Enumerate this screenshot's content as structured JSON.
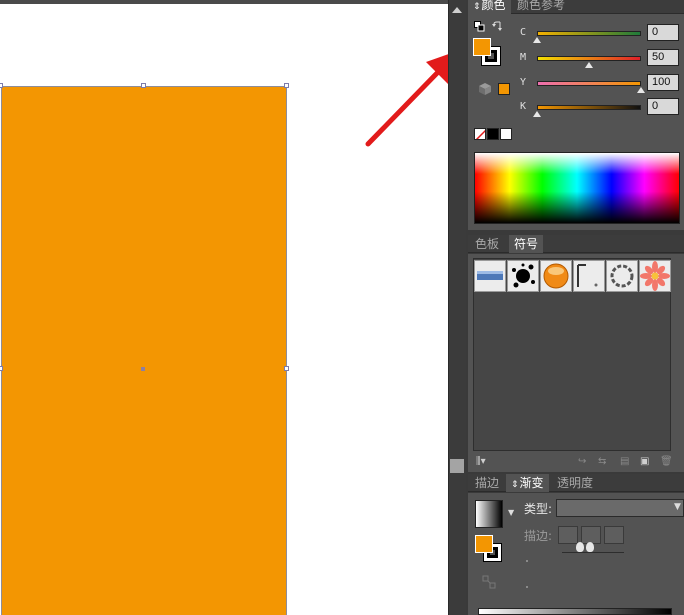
{
  "color_panel": {
    "tab_color": "颜色",
    "tab_color_guide": "颜色参考",
    "fill_color": "#f39602",
    "sliders": [
      {
        "label": "C",
        "value": "0",
        "fraction": 0.0,
        "gradient": [
          "#f3b000",
          "#1f7a3a"
        ]
      },
      {
        "label": "M",
        "value": "50",
        "fraction": 0.5,
        "gradient": [
          "#f3e000",
          "#e0202a"
        ]
      },
      {
        "label": "Y",
        "value": "100",
        "fraction": 1.0,
        "gradient": [
          "#ee6fb0",
          "#f39602"
        ]
      },
      {
        "label": "K",
        "value": "0",
        "fraction": 0.0,
        "gradient": [
          "#f39602",
          "#111111"
        ]
      }
    ]
  },
  "symbols_panel": {
    "tab_swatches": "色板",
    "tab_symbols": "符号",
    "symbols": [
      "blue-bar-symbol",
      "ink-splat-symbol",
      "orange-button-symbol",
      "frame-corner-symbol",
      "chain-ring-symbol",
      "flower-symbol"
    ]
  },
  "gradient_panel": {
    "tab_stroke": "描边",
    "tab_gradient": "渐变",
    "tab_transparency": "透明度",
    "type_label": "类型:",
    "stroke_label": "描边:"
  }
}
